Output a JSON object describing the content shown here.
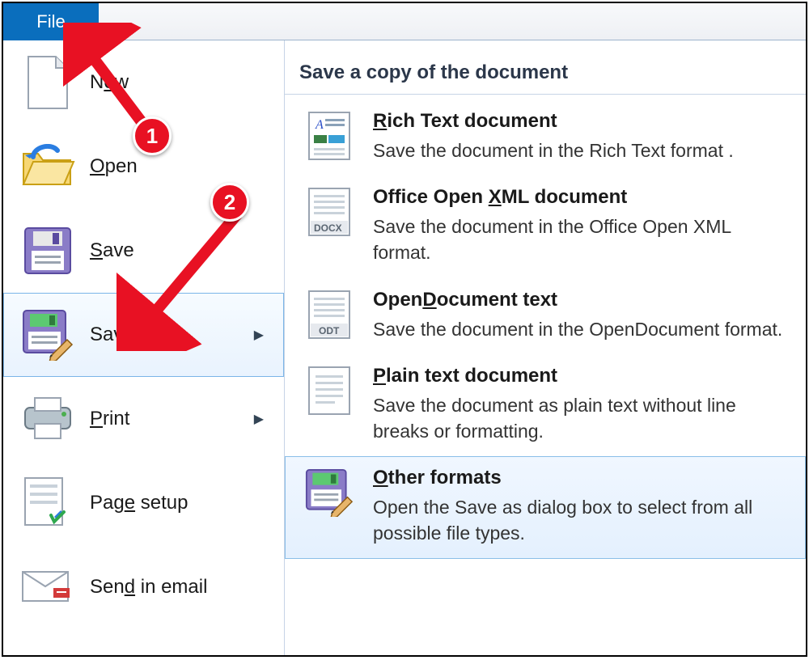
{
  "toolbar": {
    "file_tab": "File"
  },
  "menu": {
    "items": [
      {
        "label_pre": "N",
        "ul": "e",
        "label_post": "w",
        "has_arrow": false
      },
      {
        "label_pre": "",
        "ul": "O",
        "label_post": "pen",
        "has_arrow": false
      },
      {
        "label_pre": "",
        "ul": "S",
        "label_post": "ave",
        "has_arrow": false
      },
      {
        "label_pre": "Save ",
        "ul": "a",
        "label_post": "s",
        "has_arrow": true,
        "selected": true
      },
      {
        "label_pre": "",
        "ul": "P",
        "label_post": "rint",
        "has_arrow": true
      },
      {
        "label_pre": "Pag",
        "ul": "e",
        "label_post": " setup",
        "has_arrow": false
      },
      {
        "label_pre": "Sen",
        "ul": "d",
        "label_post": " in email",
        "has_arrow": false
      }
    ]
  },
  "submenu": {
    "title": "Save a copy of the document",
    "items": [
      {
        "title_pre": "",
        "ul": "R",
        "title_post": "ich Text document",
        "desc": "Save the document in the Rich Text format ."
      },
      {
        "title_pre": "Office Open ",
        "ul": "X",
        "title_post": "ML document",
        "desc": "Save the document in the Office Open XML format."
      },
      {
        "title_pre": "Open",
        "ul": "D",
        "title_post": "ocument text",
        "desc": "Save the document in the OpenDocument format."
      },
      {
        "title_pre": "",
        "ul": "P",
        "title_post": "lain text document",
        "desc": "Save the document as plain text without line breaks or formatting."
      },
      {
        "title_pre": "",
        "ul": "O",
        "title_post": "ther formats",
        "desc": "Open the Save as dialog box to select from all possible file types.",
        "highlight": true
      }
    ]
  },
  "annotations": {
    "call1": "1",
    "call2": "2"
  }
}
